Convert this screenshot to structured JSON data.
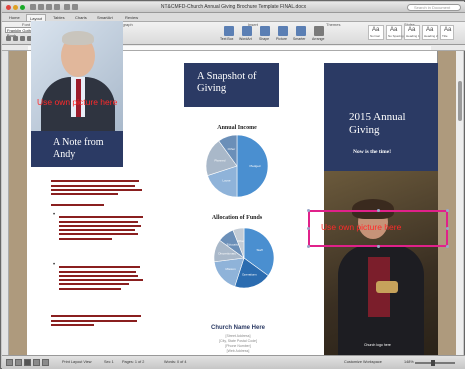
{
  "window": {
    "title": "NT&CMFD-Church Annual Giving Brochure Template FINAL.docx",
    "search_placeholder": "Search in Document"
  },
  "ribbon": {
    "tabs": [
      {
        "label": "Home",
        "active": false
      },
      {
        "label": "Layout",
        "active": true
      },
      {
        "label": "Tables",
        "active": false
      },
      {
        "label": "Charts",
        "active": false
      },
      {
        "label": "SmartArt",
        "active": false
      },
      {
        "label": "Review",
        "active": false
      }
    ],
    "groups": [
      "Font",
      "Paragraph",
      "Insert",
      "Themes",
      "Styles"
    ],
    "font_name": "Franklin Gothic Book",
    "font_size": "10",
    "zoom_display": "148%",
    "insert_buttons": [
      "Text Box",
      "WordArt",
      "Shape",
      "Picture",
      "Smarter",
      "Arrange"
    ],
    "styles": [
      {
        "sample": "Aa",
        "name": "Normal"
      },
      {
        "sample": "Aa",
        "name": "No Spacing"
      },
      {
        "sample": "Aa",
        "name": "Heading 1"
      },
      {
        "sample": "Aa",
        "name": "Heading 2"
      },
      {
        "sample": "Aa",
        "name": "Title"
      }
    ]
  },
  "document": {
    "left_panel": {
      "placeholder_photo": "Use own picture here",
      "title": "A Note from Andy",
      "bullet": "•"
    },
    "middle_panel": {
      "title": "A Snapshot of Giving",
      "income_chart_title": "Annual Income",
      "funds_chart_title": "Allocation of Funds",
      "church_name": "Church Name Here",
      "address_lines": [
        "[Street Address]",
        "[City, State Postal Code]",
        "[Phone Number]",
        "[Web Address]"
      ]
    },
    "right_panel": {
      "title": "2015 Annual Giving",
      "subtitle": "Now is the time!",
      "placeholder_photo": "Use own picture here",
      "logo_text": "Church logo here"
    }
  },
  "status_bar": {
    "fields": [
      "Print Layout View",
      "Sec 1",
      "Pages: 1 of 2",
      "Words: 0 of 4",
      "Customize Workspace"
    ],
    "zoom": "148%"
  },
  "chart_data": [
    {
      "type": "pie",
      "title": "Annual Income",
      "categories": [
        "Pledged",
        "Loose",
        "Planned",
        "Other"
      ],
      "values": [
        50,
        20,
        20,
        10
      ],
      "colors": [
        "#4a8fd0",
        "#8fb3d9",
        "#a9b8c9",
        "#6b8fb8"
      ]
    },
    {
      "type": "pie",
      "title": "Allocation of Funds",
      "categories": [
        "Staff",
        "Operations",
        "Mission",
        "Discretionary",
        "Education",
        "Other"
      ],
      "values": [
        35,
        20,
        18,
        12,
        9,
        6
      ],
      "colors": [
        "#4a8fd0",
        "#2b6cb0",
        "#8fb3d9",
        "#a9b8c9",
        "#6b8fb8",
        "#c3ccd6"
      ]
    }
  ]
}
